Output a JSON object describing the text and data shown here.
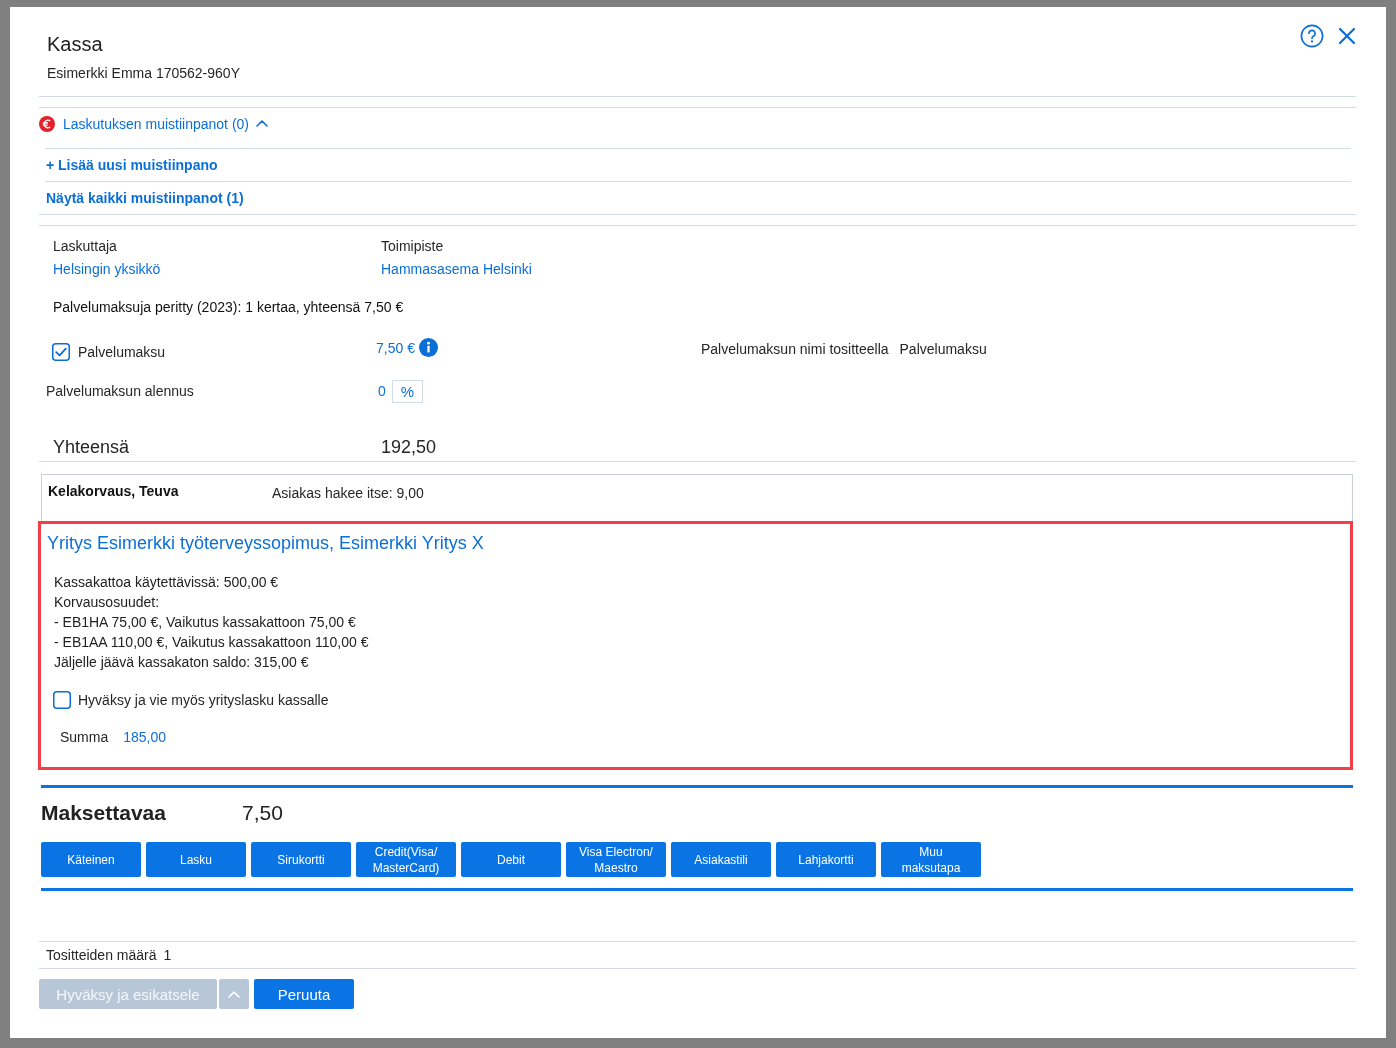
{
  "dialog": {
    "title": "Kassa",
    "subtitle": "Esimerkki Emma 170562-960Y"
  },
  "notes": {
    "label": "Laskutuksen muistiinpanot (0)",
    "expanded": true,
    "links": [
      "+ Lisää uusi muistiinpano",
      "Näytä kaikki muistiinpanot (1)"
    ]
  },
  "billing": [
    {
      "label": "Laskuttaja",
      "value": "Helsingin yksikkö"
    },
    {
      "label": "Toimipiste",
      "value": "Hammasasema Helsinki"
    }
  ],
  "service_fee_info": "Palvelumaksuja peritty (2023): 1 kertaa, yhteensä 7,50 €",
  "service_fee": {
    "label": "Palvelumaksu",
    "checked": true,
    "amount": "7,50 €",
    "name_label": "Palvelumaksun nimi tositteella",
    "name_value": "Palvelumaksu"
  },
  "discount": {
    "label": "Palvelumaksun alennus",
    "value": "0",
    "unit": "%"
  },
  "total": {
    "label": "Yhteensä",
    "value": "192,50"
  },
  "reimbursement": {
    "title": "Kelakorvaus, Teuva",
    "note": "Asiakas hakee itse: 9,00"
  },
  "contract": {
    "highlighted": true,
    "title": "Yritys Esimerkki työterveyssopimus, Esimerkki Yritys X",
    "details": [
      "Kassakattoa käytettävissä: 500,00 €",
      "Korvausosuudet:",
      "- EB1HA 75,00 €, Vaikutus kassakattoon 75,00 €",
      "- EB1AA 110,00 €, Vaikutus kassakattoon 110,00 €",
      "Jäljelle jäävä kassakaton saldo: 315,00 €"
    ],
    "approve": {
      "label": "Hyväksy ja vie myös yrityslasku kassalle",
      "checked": false
    },
    "sum_label": "Summa",
    "sum_value": "185,00"
  },
  "payable": {
    "label": "Maksettavaa",
    "value": "7,50"
  },
  "payment_methods": [
    "Käteinen",
    "Lasku",
    "Sirukortti",
    "Credit(Visa/MasterCard)",
    "Debit",
    "Visa Electron/Maestro",
    "Asiakastili",
    "Lahjakortti",
    "Muu maksutapa"
  ],
  "footer": {
    "receipts_label": "Tositteiden määrä",
    "receipts_count": "1"
  },
  "actions": [
    {
      "kind": "split",
      "label": "Hyväksy ja esikatsele",
      "disabled": true
    },
    {
      "kind": "plain",
      "label": "Peruuta",
      "disabled": false
    }
  ]
}
